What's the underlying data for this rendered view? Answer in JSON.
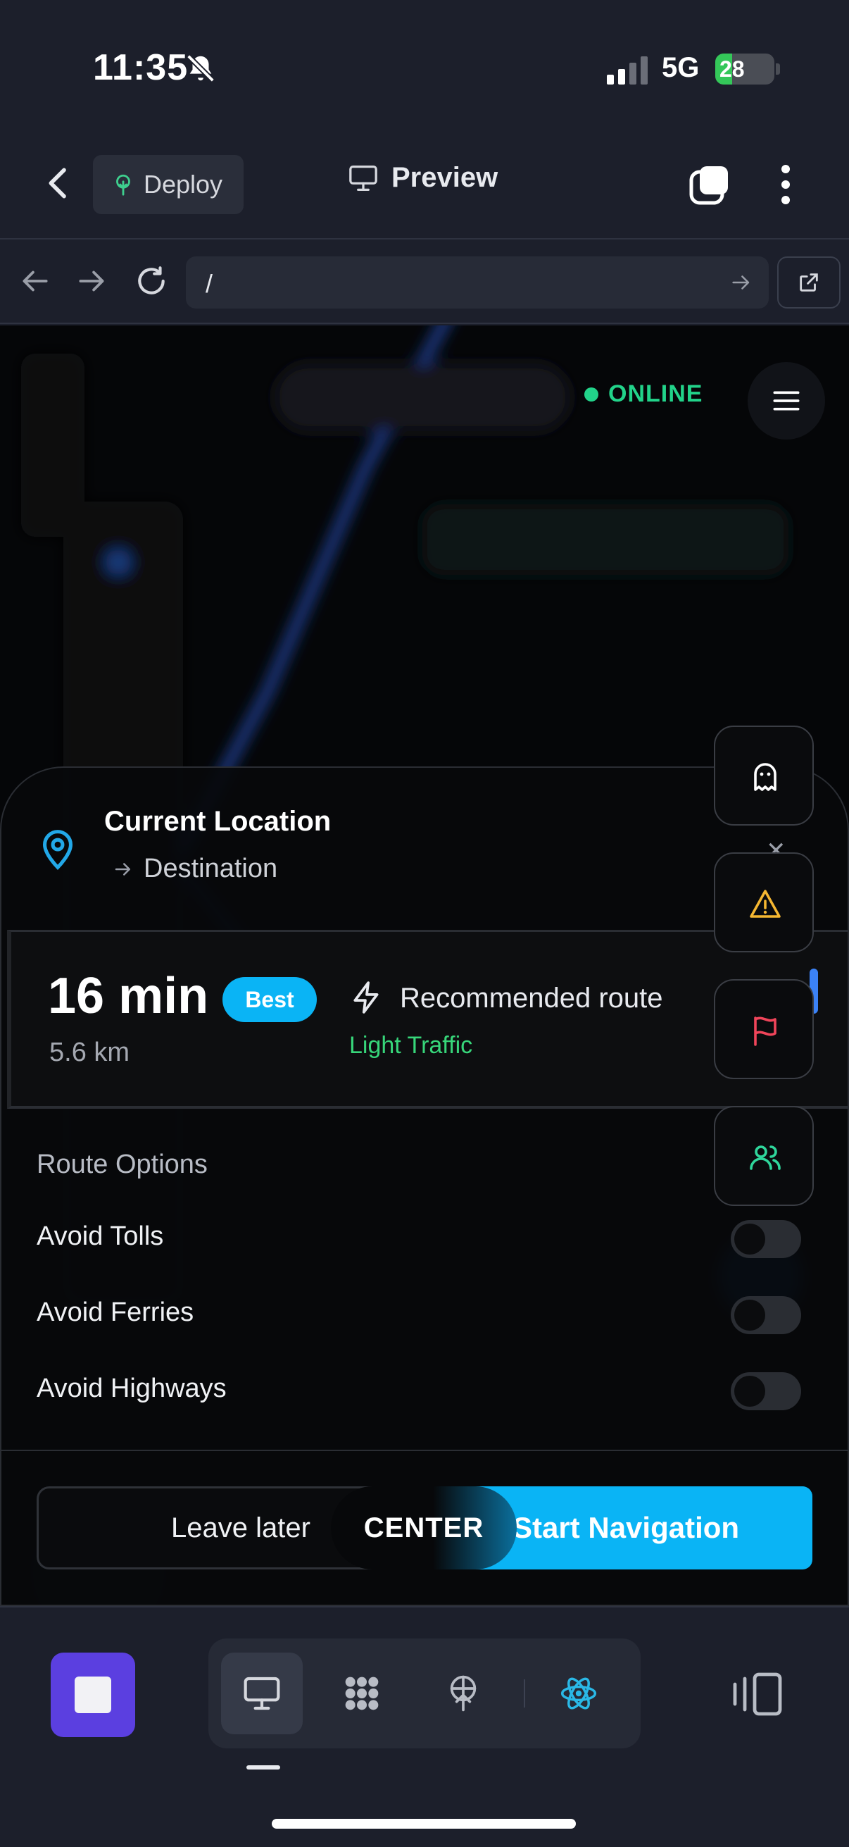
{
  "status_bar": {
    "time": "11:35",
    "network": "5G",
    "battery_percent": "28",
    "battery_level": 0.28,
    "icons": [
      "bell-slash-icon",
      "signal-icon",
      "battery-charging-icon"
    ]
  },
  "toolbar": {
    "deploy_label": "Deploy",
    "preview_label": "Preview",
    "icons": [
      "chevron-left-icon",
      "tree-icon",
      "monitor-icon",
      "tabs-icon",
      "more-vertical-icon"
    ]
  },
  "browser": {
    "url": "/",
    "icons": [
      "arrow-left-icon",
      "arrow-right-icon",
      "reload-icon",
      "arrow-go-icon",
      "external-link-icon"
    ]
  },
  "app": {
    "status": "ONLINE",
    "colors": {
      "online": "#22d38a",
      "accent": "#0ab4f5",
      "traffic": "#37d67a"
    },
    "trip": {
      "from": "Current Location",
      "to": "Destination"
    },
    "route": {
      "eta": "16 min",
      "badge": "Best",
      "distance": "5.6 km",
      "name": "Recommended route",
      "traffic": "Light Traffic"
    },
    "options": {
      "title": "Route Options",
      "items": [
        {
          "label": "Avoid Tolls",
          "enabled": false
        },
        {
          "label": "Avoid Ferries",
          "enabled": false
        },
        {
          "label": "Avoid Highways",
          "enabled": false
        }
      ]
    },
    "actions": {
      "leave_later": "Leave later",
      "center": "CENTER",
      "start": "Start Navigation"
    },
    "floating_buttons": [
      "ghost-icon",
      "warning-icon",
      "flag-icon",
      "users-icon"
    ]
  },
  "dock": {
    "items": [
      "stop-icon",
      "monitor-icon",
      "apps-grid-icon",
      "deploy-antenna-icon",
      "react-atom-icon",
      "split-panels-icon"
    ]
  }
}
